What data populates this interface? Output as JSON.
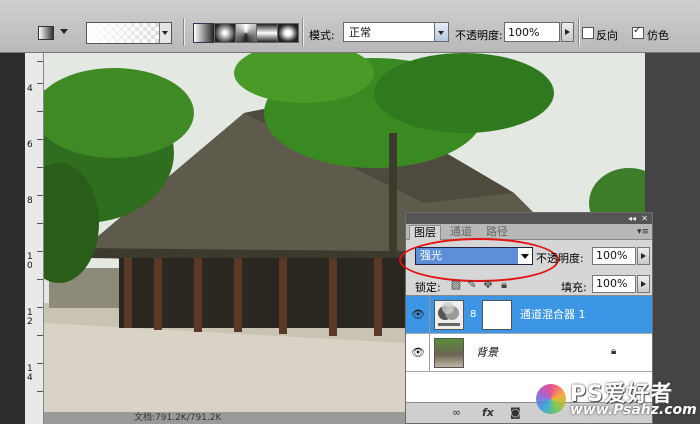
{
  "options_bar": {
    "mode_label": "模式:",
    "mode_value": "正常",
    "opacity_label": "不透明度:",
    "opacity_value": "100%",
    "reverse_label": "反向",
    "dither_label": "仿色",
    "reverse_checked": false,
    "dither_checked": true
  },
  "ruler": {
    "labels": [
      "4",
      "6",
      "8",
      "1\n0",
      "1\n2",
      "1\n4"
    ]
  },
  "status_bar": {
    "text": "文档:791.2K/791.2K"
  },
  "layers_panel": {
    "tabs": [
      "图层",
      "通道",
      "路径"
    ],
    "active_tab": "图层",
    "blend_mode": "强光",
    "opacity_label": "不透明度:",
    "opacity_value": "100%",
    "lock_label": "锁定:",
    "fill_label": "填充:",
    "fill_value": "100%",
    "layers": [
      {
        "name": "通道混合器 1",
        "selected": true,
        "type": "adjustment"
      },
      {
        "name": "背景",
        "selected": false,
        "type": "image",
        "locked": true
      }
    ]
  },
  "watermark": {
    "line1": "PS爱好者",
    "line2": "www.Psahz.com"
  },
  "colors": {
    "selection_blue": "#3d95e6",
    "highlight_red": "#e01212"
  }
}
